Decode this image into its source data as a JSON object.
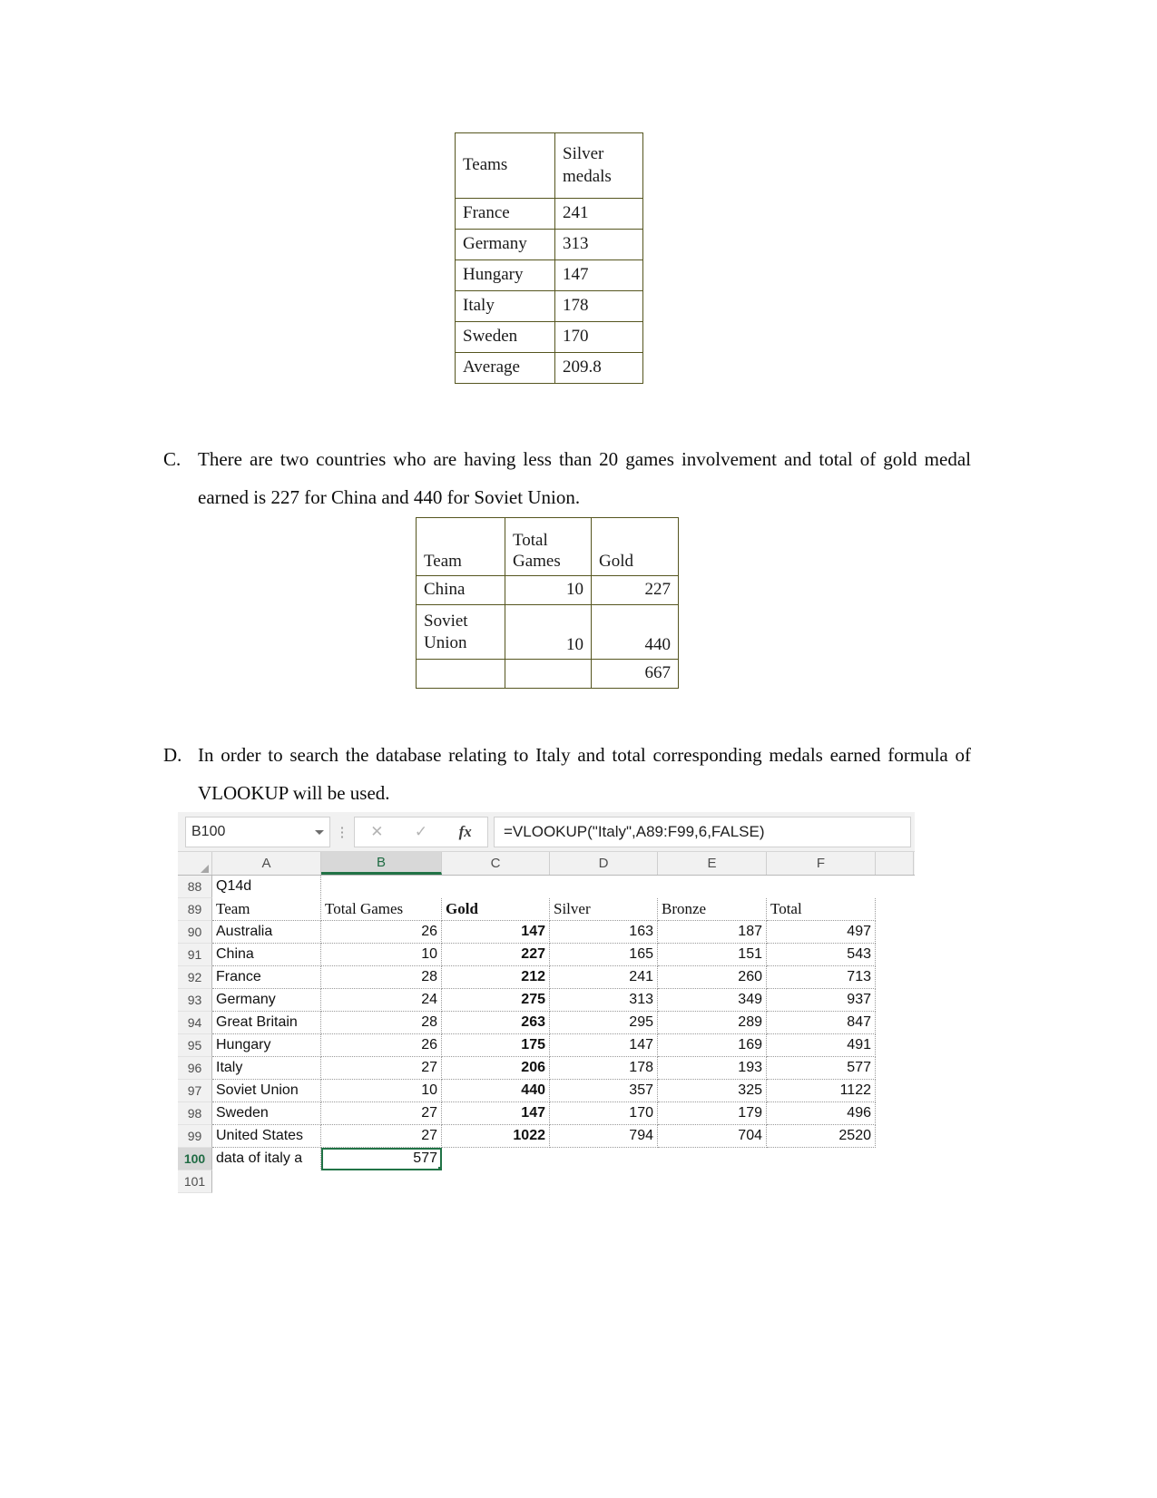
{
  "table_silver": {
    "headers": [
      "Teams",
      "Silver\nmedals"
    ],
    "header_team": "Teams",
    "header_silver_line1": "Silver",
    "header_silver_line2": "medals",
    "rows": [
      {
        "team": "France",
        "silver": "241"
      },
      {
        "team": "Germany",
        "silver": "313"
      },
      {
        "team": "Hungary",
        "silver": "147"
      },
      {
        "team": "Italy",
        "silver": "178"
      },
      {
        "team": "Sweden",
        "silver": "170"
      },
      {
        "team": "Average",
        "silver": "209.8"
      }
    ]
  },
  "para_c": {
    "marker": "C.",
    "text": "There are two countries who are having less than 20 games involvement and total of gold medal earned is 227 for China and 440 for Soviet Union."
  },
  "table_gold": {
    "header_team": "Team",
    "header_games_line1": "Total",
    "header_games_line2": "Games",
    "header_gold": "Gold",
    "rows": [
      {
        "team": "China",
        "games": "10",
        "gold": "227"
      },
      {
        "team": "Soviet\nUnion",
        "team_line1": "Soviet",
        "team_line2": "Union",
        "games": "10",
        "gold": "440"
      },
      {
        "team": "",
        "games": "",
        "gold": "667"
      }
    ]
  },
  "para_d": {
    "marker": "D.",
    "text": "In order to search the database relating to Italy and total corresponding medals earned formula of VLOOKUP will be used."
  },
  "excel": {
    "name_box": "B100",
    "formula": "=VLOOKUP(\"Italy\",A89:F99,6,FALSE)",
    "cancel_icon": "✕",
    "confirm_icon": "✓",
    "fx_label": "fx",
    "selected_column": "B",
    "columns": [
      "A",
      "B",
      "C",
      "D",
      "E",
      "F"
    ],
    "accent_color": "#217346",
    "error_flag_color": "#1f7a3d",
    "rows": [
      {
        "num": "88",
        "a": "Q14d",
        "b": "",
        "c": "",
        "d": "",
        "e": "",
        "f": ""
      },
      {
        "num": "89",
        "a": "Team",
        "b": "Total Games",
        "c": "Gold",
        "d": "Silver",
        "e": "Bronze",
        "f": "Total"
      },
      {
        "num": "90",
        "a": "Australia",
        "b": "26",
        "c": "147",
        "d": "163",
        "e": "187",
        "f": "497"
      },
      {
        "num": "91",
        "a": "China",
        "b": "10",
        "c": "227",
        "d": "165",
        "e": "151",
        "f": "543"
      },
      {
        "num": "92",
        "a": "France",
        "b": "28",
        "c": "212",
        "d": "241",
        "e": "260",
        "f": "713"
      },
      {
        "num": "93",
        "a": "Germany",
        "b": "24",
        "c": "275",
        "d": "313",
        "e": "349",
        "f": "937"
      },
      {
        "num": "94",
        "a": "Great Britain",
        "b": "28",
        "c": "263",
        "d": "295",
        "e": "289",
        "f": "847"
      },
      {
        "num": "95",
        "a": "Hungary",
        "b": "26",
        "c": "175",
        "d": "147",
        "e": "169",
        "f": "491"
      },
      {
        "num": "96",
        "a": "Italy",
        "b": "27",
        "c": "206",
        "d": "178",
        "e": "193",
        "f": "577"
      },
      {
        "num": "97",
        "a": "Soviet Union",
        "b": "10",
        "c": "440",
        "d": "357",
        "e": "325",
        "f": "1122"
      },
      {
        "num": "98",
        "a": "Sweden",
        "b": "27",
        "c": "147",
        "d": "170",
        "e": "179",
        "f": "496"
      },
      {
        "num": "99",
        "a": "United States",
        "b": "27",
        "c": "1022",
        "d": "794",
        "e": "704",
        "f": "2520"
      },
      {
        "num": "100",
        "a": "data of italy a",
        "b": "577",
        "c": "",
        "d": "",
        "e": "",
        "f": ""
      },
      {
        "num": "101",
        "a": "",
        "b": "",
        "c": "",
        "d": "",
        "e": "",
        "f": ""
      }
    ]
  }
}
